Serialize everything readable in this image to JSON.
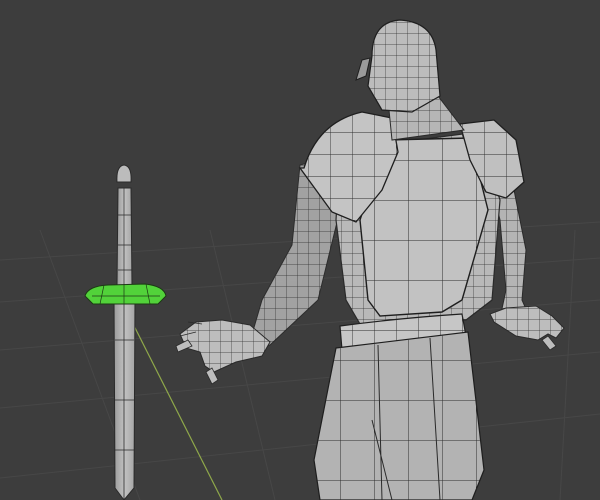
{
  "viewport": {
    "background_color": "#3d3d3d",
    "grid_line_color": "#4a4a4a",
    "y_axis_color": "#8fa84a",
    "wire_color": "#2a2a2a",
    "mesh_fill_color": "#b9b9b9",
    "mesh_shadow_color": "#8e8e8e",
    "selected_face_color": "#52d23a",
    "selected_edge_color": "#e8e8e8",
    "display_mode": "solid-wireframe",
    "icon_names": [
      "knight-mesh-icon",
      "sword-mesh-icon"
    ]
  }
}
